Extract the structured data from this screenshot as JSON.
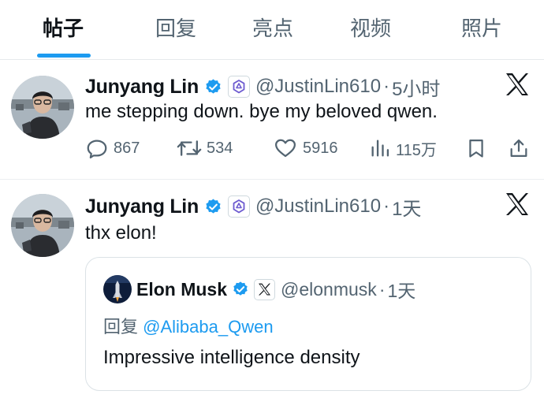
{
  "tabs": [
    {
      "label": "帖子",
      "active": true
    },
    {
      "label": "回复"
    },
    {
      "label": "亮点"
    },
    {
      "label": "视频"
    },
    {
      "label": "照片"
    }
  ],
  "colors": {
    "accent": "#1d9bf0",
    "secondary_text": "#536471",
    "verified": "#1d9bf0"
  },
  "tweets": [
    {
      "name": "Junyang Lin",
      "handle": "@JustinLin610",
      "sep": "·",
      "time": "5小时",
      "text": "me stepping down. bye my beloved qwen.",
      "replies": "867",
      "retweets": "534",
      "likes": "5916",
      "views": "115万"
    },
    {
      "name": "Junyang Lin",
      "handle": "@JustinLin610",
      "sep": "·",
      "time": "1天",
      "text": "thx elon!",
      "quote": {
        "name": "Elon Musk",
        "handle": "@elonmusk",
        "sep": "·",
        "time": "1天",
        "reply_prefix": "回复 ",
        "reply_to": "@Alibaba_Qwen",
        "text": "Impressive intelligence density"
      }
    }
  ]
}
